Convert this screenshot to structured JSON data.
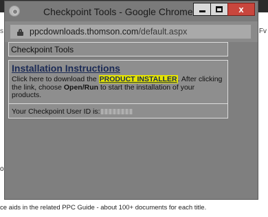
{
  "background": {
    "fragment_right": "Fv",
    "fragment_left": "s",
    "fragment_o": "o",
    "footer_line": "ce aids in the related PPC Guide - about 100+ documents for each title.",
    "footer_line2": "... ... ... ... ... ... ... ... ... ... ... ... ... ... ... ... ... ... ..."
  },
  "window": {
    "title": "Checkpoint Tools - Google Chrome",
    "close_glyph": "x"
  },
  "address": {
    "domain": "ppcdownloads.thomson.com",
    "path": "/default.aspx"
  },
  "page": {
    "header_title": "Checkpoint Tools",
    "install_heading": "Installation Instructions",
    "install_prefix": "Click here to download the ",
    "install_link": "PRODUCT INSTALLER",
    "install_mid": ". After clicking the link, choose ",
    "install_bold": "Open/Run",
    "install_suffix": " to start the installation of your products.",
    "user_id_label": "Your Checkpoint User ID is:"
  }
}
